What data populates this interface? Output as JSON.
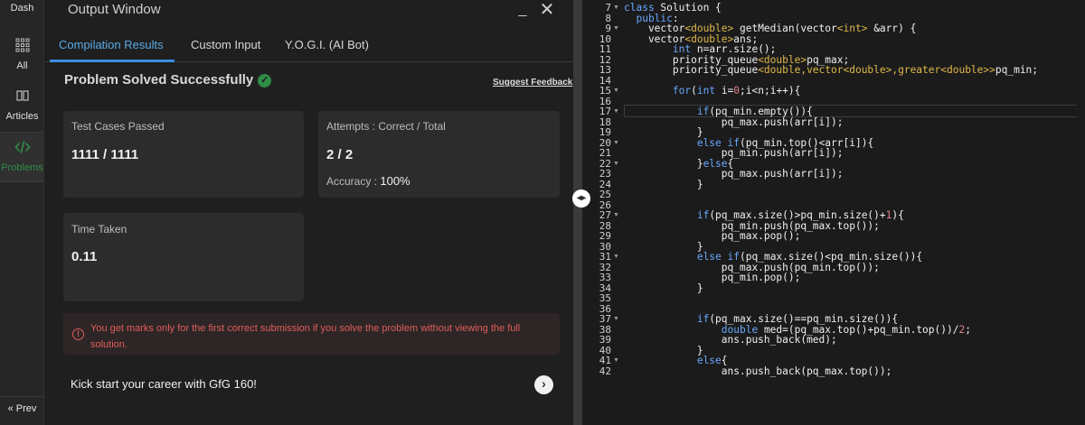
{
  "nav": {
    "top_label": "Dash",
    "items": [
      {
        "label": "All",
        "icon": "grid-icon"
      },
      {
        "label": "Articles",
        "icon": "book-icon"
      },
      {
        "label": "Problems",
        "icon": "code-icon"
      }
    ],
    "prev_label": "« Prev"
  },
  "output": {
    "title": "Output Window",
    "minimize_glyph": "_",
    "close_glyph": "✕",
    "tabs": [
      "Compilation Results",
      "Custom Input",
      "Y.O.G.I. (AI Bot)"
    ],
    "active_tab": "Compilation Results",
    "status": "Problem Solved Successfully",
    "feedback_link": "Suggest Feedback",
    "cards": {
      "tests": {
        "label": "Test Cases Passed",
        "value": "1111 / 1111"
      },
      "attempts": {
        "label": "Attempts : Correct / Total",
        "value": "2 / 2",
        "accuracy_label": "Accuracy :",
        "accuracy_value": "100%"
      },
      "time": {
        "label": "Time Taken",
        "value": "0.11"
      }
    },
    "warning": "You get marks only for the first correct submission if you solve the problem without viewing the full solution.",
    "promo": "Kick start your career with GfG 160!"
  },
  "editor": {
    "lines": [
      {
        "n": "7",
        "fold": true,
        "code": "class Solution {"
      },
      {
        "n": "8",
        "fold": false,
        "code": "  public:"
      },
      {
        "n": "9",
        "fold": true,
        "code": "    vector<double> getMedian(vector<int> &arr) {"
      },
      {
        "n": "10",
        "fold": false,
        "code": "    vector<double>ans;"
      },
      {
        "n": "11",
        "fold": false,
        "code": "        int n=arr.size();"
      },
      {
        "n": "12",
        "fold": false,
        "code": "        priority_queue<double>pq_max;"
      },
      {
        "n": "13",
        "fold": false,
        "code": "        priority_queue<double,vector<double>,greater<double>>pq_min;"
      },
      {
        "n": "14",
        "fold": false,
        "code": ""
      },
      {
        "n": "15",
        "fold": true,
        "code": "        for(int i=0;i<n;i++){"
      },
      {
        "n": "16",
        "fold": false,
        "code": ""
      },
      {
        "n": "17",
        "fold": true,
        "code": "            if(pq_min.empty()){"
      },
      {
        "n": "18",
        "fold": false,
        "code": "                pq_max.push(arr[i]);"
      },
      {
        "n": "19",
        "fold": false,
        "code": "            }"
      },
      {
        "n": "20",
        "fold": true,
        "code": "            else if(pq_min.top()<arr[i]){"
      },
      {
        "n": "21",
        "fold": false,
        "code": "                pq_min.push(arr[i]);"
      },
      {
        "n": "22",
        "fold": true,
        "code": "            }else{"
      },
      {
        "n": "23",
        "fold": false,
        "code": "                pq_max.push(arr[i]);"
      },
      {
        "n": "24",
        "fold": false,
        "code": "            }"
      },
      {
        "n": "25",
        "fold": false,
        "code": ""
      },
      {
        "n": "26",
        "fold": false,
        "code": ""
      },
      {
        "n": "27",
        "fold": true,
        "code": "            if(pq_max.size()>pq_min.size()+1){"
      },
      {
        "n": "28",
        "fold": false,
        "code": "                pq_min.push(pq_max.top());"
      },
      {
        "n": "29",
        "fold": false,
        "code": "                pq_max.pop();"
      },
      {
        "n": "30",
        "fold": false,
        "code": "            }"
      },
      {
        "n": "31",
        "fold": true,
        "code": "            else if(pq_max.size()<pq_min.size()){"
      },
      {
        "n": "32",
        "fold": false,
        "code": "                pq_max.push(pq_min.top());"
      },
      {
        "n": "33",
        "fold": false,
        "code": "                pq_min.pop();"
      },
      {
        "n": "34",
        "fold": false,
        "code": "            }"
      },
      {
        "n": "35",
        "fold": false,
        "code": ""
      },
      {
        "n": "36",
        "fold": false,
        "code": ""
      },
      {
        "n": "37",
        "fold": true,
        "code": "            if(pq_max.size()==pq_min.size()){"
      },
      {
        "n": "38",
        "fold": false,
        "code": "                double med=(pq_max.top()+pq_min.top())/2;"
      },
      {
        "n": "39",
        "fold": false,
        "code": "                ans.push_back(med);"
      },
      {
        "n": "40",
        "fold": false,
        "code": "            }"
      },
      {
        "n": "41",
        "fold": true,
        "code": "            else{"
      },
      {
        "n": "42",
        "fold": false,
        "code": "                ans.push_back(pq_max.top());"
      }
    ]
  },
  "colors": {
    "accent_green": "#2f8d46",
    "tab_blue": "#3a8ee0",
    "warning_red": "#e05c5c",
    "code_keyword": "#6aa8ff",
    "code_type": "#e0b84a",
    "code_number": "#e0808a"
  }
}
